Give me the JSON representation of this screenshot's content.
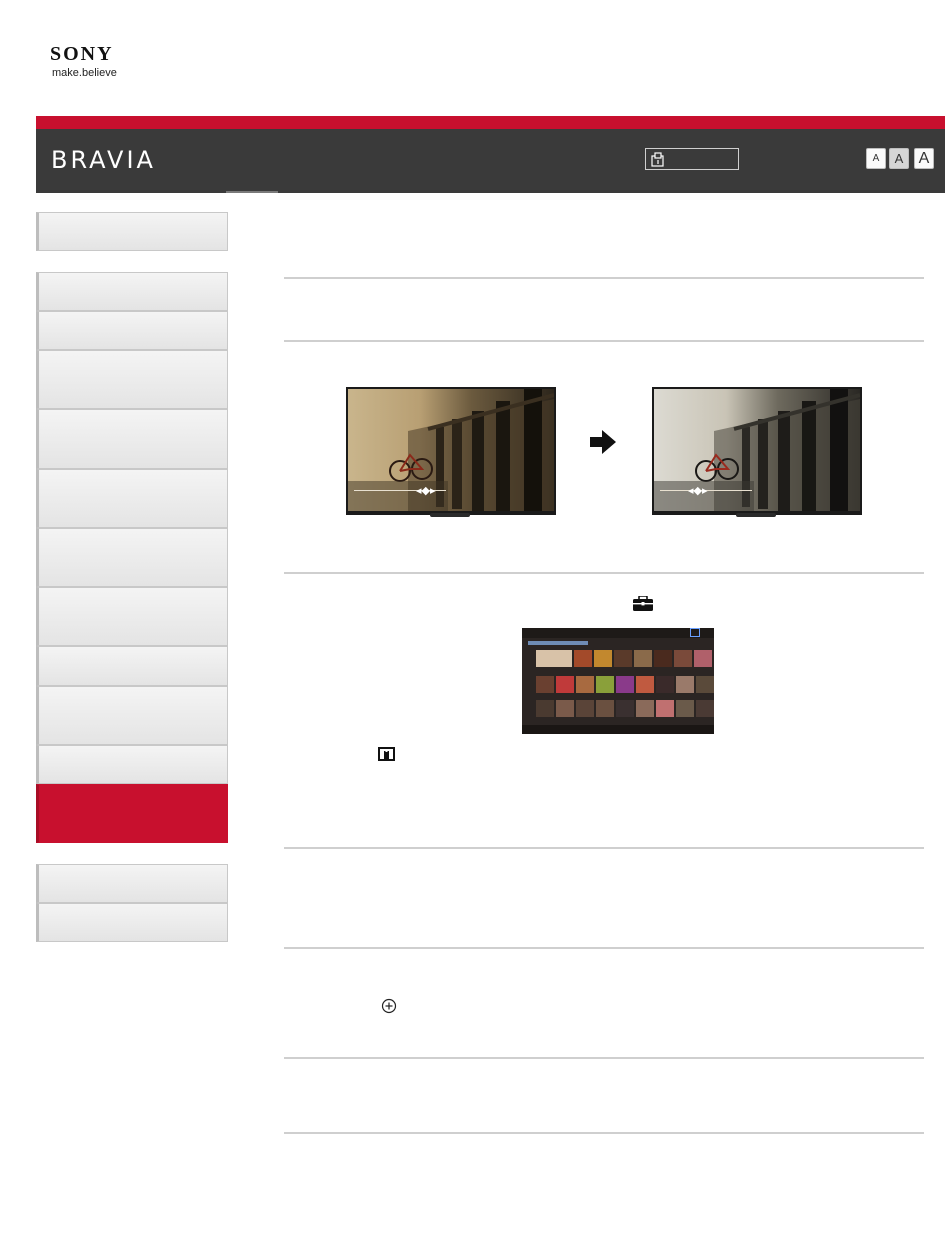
{
  "brand": {
    "logo_text": "SONY",
    "tagline": "make.believe",
    "primary_color": "#c8102e",
    "header_color": "#3a3a3a"
  },
  "header": {
    "product_name": "BRAVIA",
    "search_icon": "search-document-icon",
    "font_size_buttons": [
      {
        "label": "A",
        "size": "small"
      },
      {
        "label": "A",
        "size": "medium",
        "selected": true
      },
      {
        "label": "A",
        "size": "large"
      }
    ]
  },
  "sidebar": {
    "groups": [
      {
        "items": [
          {
            "label": ""
          }
        ]
      },
      {
        "items": [
          {
            "label": ""
          },
          {
            "label": ""
          },
          {
            "label": ""
          },
          {
            "label": ""
          },
          {
            "label": ""
          },
          {
            "label": ""
          },
          {
            "label": ""
          },
          {
            "label": ""
          },
          {
            "label": ""
          },
          {
            "label": ""
          },
          {
            "label": "",
            "active": true
          }
        ]
      },
      {
        "items": [
          {
            "label": ""
          },
          {
            "label": ""
          }
        ]
      }
    ]
  },
  "content": {
    "comparison_images": {
      "before": "tv-screen-before-image",
      "after": "tv-screen-after-image",
      "arrow_icon": "right-arrow-icon"
    },
    "toolbox_icon": "toolbox-icon",
    "home_menu_image": "home-menu-screenshot",
    "info_icon": "info-icon",
    "target_icon": "crosshair-circle-icon"
  }
}
